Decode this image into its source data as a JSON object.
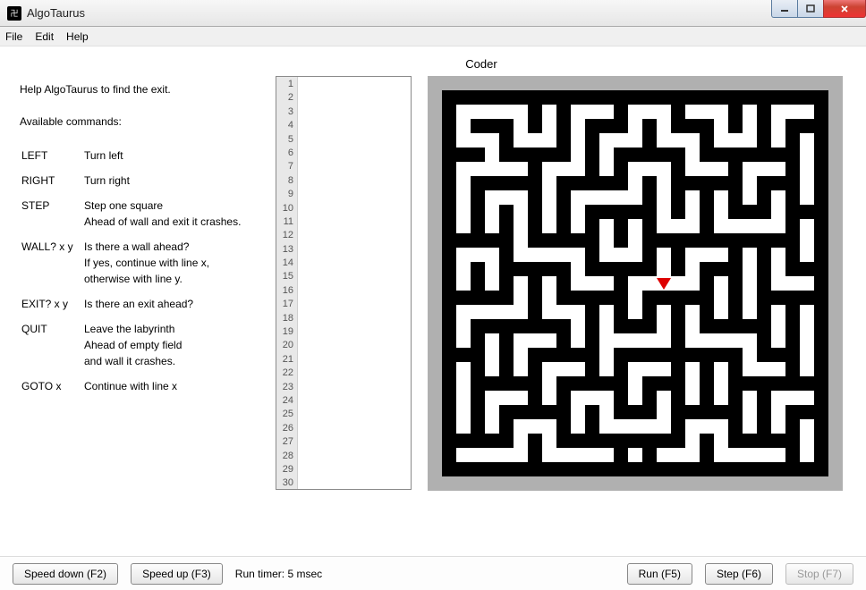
{
  "window": {
    "title": "AlgoTaurus",
    "icon_glyph": "卍"
  },
  "menu": [
    "File",
    "Edit",
    "Help"
  ],
  "labels": {
    "coder_header": "Coder"
  },
  "help": {
    "intro": "Help AlgoTaurus to find the exit.",
    "avail": "Available commands:",
    "cmds": [
      {
        "cmd": "LEFT",
        "desc": "Turn left"
      },
      {
        "cmd": "RIGHT",
        "desc": "Turn right"
      },
      {
        "cmd": "STEP",
        "desc": "Step one square\nAhead of wall and exit it crashes."
      },
      {
        "cmd": "WALL? x y",
        "desc": "Is there a wall ahead?\nIf yes, continue with line x,\notherwise with line y."
      },
      {
        "cmd": "EXIT? x y",
        "desc": "Is there an exit ahead?"
      },
      {
        "cmd": "QUIT",
        "desc": "Leave the labyrinth\nAhead of empty field\nand wall it crashes."
      },
      {
        "cmd": "GOTO x",
        "desc": "Continue with line x"
      }
    ]
  },
  "editor": {
    "line_count": 30
  },
  "maze": {
    "grid_size": 27,
    "player": {
      "col": 15,
      "row": 13
    },
    "open_cells": [
      [
        1,
        1
      ],
      [
        2,
        1
      ],
      [
        3,
        1
      ],
      [
        4,
        1
      ],
      [
        5,
        1
      ],
      [
        7,
        1
      ],
      [
        9,
        1
      ],
      [
        10,
        1
      ],
      [
        11,
        1
      ],
      [
        13,
        1
      ],
      [
        14,
        1
      ],
      [
        15,
        1
      ],
      [
        17,
        1
      ],
      [
        18,
        1
      ],
      [
        19,
        1
      ],
      [
        21,
        1
      ],
      [
        23,
        1
      ],
      [
        24,
        1
      ],
      [
        25,
        1
      ],
      [
        1,
        2
      ],
      [
        5,
        2
      ],
      [
        7,
        2
      ],
      [
        9,
        2
      ],
      [
        13,
        2
      ],
      [
        15,
        2
      ],
      [
        19,
        2
      ],
      [
        21,
        2
      ],
      [
        23,
        2
      ],
      [
        1,
        3
      ],
      [
        2,
        3
      ],
      [
        3,
        3
      ],
      [
        5,
        3
      ],
      [
        6,
        3
      ],
      [
        7,
        3
      ],
      [
        9,
        3
      ],
      [
        11,
        3
      ],
      [
        12,
        3
      ],
      [
        13,
        3
      ],
      [
        15,
        3
      ],
      [
        16,
        3
      ],
      [
        17,
        3
      ],
      [
        19,
        3
      ],
      [
        20,
        3
      ],
      [
        21,
        3
      ],
      [
        23,
        3
      ],
      [
        25,
        3
      ],
      [
        3,
        4
      ],
      [
        9,
        4
      ],
      [
        11,
        4
      ],
      [
        17,
        4
      ],
      [
        25,
        4
      ],
      [
        1,
        5
      ],
      [
        2,
        5
      ],
      [
        3,
        5
      ],
      [
        4,
        5
      ],
      [
        5,
        5
      ],
      [
        7,
        5
      ],
      [
        8,
        5
      ],
      [
        9,
        5
      ],
      [
        11,
        5
      ],
      [
        13,
        5
      ],
      [
        14,
        5
      ],
      [
        15,
        5
      ],
      [
        17,
        5
      ],
      [
        18,
        5
      ],
      [
        19,
        5
      ],
      [
        21,
        5
      ],
      [
        22,
        5
      ],
      [
        23,
        5
      ],
      [
        25,
        5
      ],
      [
        1,
        6
      ],
      [
        7,
        6
      ],
      [
        13,
        6
      ],
      [
        15,
        6
      ],
      [
        21,
        6
      ],
      [
        25,
        6
      ],
      [
        1,
        7
      ],
      [
        3,
        7
      ],
      [
        4,
        7
      ],
      [
        5,
        7
      ],
      [
        7,
        7
      ],
      [
        9,
        7
      ],
      [
        10,
        7
      ],
      [
        11,
        7
      ],
      [
        12,
        7
      ],
      [
        13,
        7
      ],
      [
        15,
        7
      ],
      [
        17,
        7
      ],
      [
        19,
        7
      ],
      [
        21,
        7
      ],
      [
        23,
        7
      ],
      [
        25,
        7
      ],
      [
        1,
        8
      ],
      [
        3,
        8
      ],
      [
        5,
        8
      ],
      [
        7,
        8
      ],
      [
        9,
        8
      ],
      [
        15,
        8
      ],
      [
        17,
        8
      ],
      [
        19,
        8
      ],
      [
        23,
        8
      ],
      [
        1,
        9
      ],
      [
        3,
        9
      ],
      [
        5,
        9
      ],
      [
        7,
        9
      ],
      [
        9,
        9
      ],
      [
        11,
        9
      ],
      [
        13,
        9
      ],
      [
        15,
        9
      ],
      [
        16,
        9
      ],
      [
        17,
        9
      ],
      [
        19,
        9
      ],
      [
        20,
        9
      ],
      [
        21,
        9
      ],
      [
        22,
        9
      ],
      [
        23,
        9
      ],
      [
        25,
        9
      ],
      [
        5,
        10
      ],
      [
        11,
        10
      ],
      [
        13,
        10
      ],
      [
        25,
        10
      ],
      [
        1,
        11
      ],
      [
        2,
        11
      ],
      [
        3,
        11
      ],
      [
        5,
        11
      ],
      [
        6,
        11
      ],
      [
        7,
        11
      ],
      [
        8,
        11
      ],
      [
        9,
        11
      ],
      [
        11,
        11
      ],
      [
        12,
        11
      ],
      [
        13,
        11
      ],
      [
        15,
        11
      ],
      [
        17,
        11
      ],
      [
        18,
        11
      ],
      [
        19,
        11
      ],
      [
        21,
        11
      ],
      [
        23,
        11
      ],
      [
        25,
        11
      ],
      [
        1,
        12
      ],
      [
        3,
        12
      ],
      [
        9,
        12
      ],
      [
        15,
        12
      ],
      [
        17,
        12
      ],
      [
        21,
        12
      ],
      [
        23,
        12
      ],
      [
        1,
        13
      ],
      [
        3,
        13
      ],
      [
        5,
        13
      ],
      [
        7,
        13
      ],
      [
        9,
        13
      ],
      [
        10,
        13
      ],
      [
        11,
        13
      ],
      [
        13,
        13
      ],
      [
        14,
        13
      ],
      [
        15,
        13
      ],
      [
        16,
        13
      ],
      [
        17,
        13
      ],
      [
        19,
        13
      ],
      [
        21,
        13
      ],
      [
        23,
        13
      ],
      [
        24,
        13
      ],
      [
        25,
        13
      ],
      [
        5,
        14
      ],
      [
        7,
        14
      ],
      [
        13,
        14
      ],
      [
        19,
        14
      ],
      [
        21,
        14
      ],
      [
        1,
        15
      ],
      [
        2,
        15
      ],
      [
        3,
        15
      ],
      [
        4,
        15
      ],
      [
        5,
        15
      ],
      [
        7,
        15
      ],
      [
        8,
        15
      ],
      [
        9,
        15
      ],
      [
        11,
        15
      ],
      [
        13,
        15
      ],
      [
        15,
        15
      ],
      [
        17,
        15
      ],
      [
        19,
        15
      ],
      [
        21,
        15
      ],
      [
        23,
        15
      ],
      [
        25,
        15
      ],
      [
        1,
        16
      ],
      [
        9,
        16
      ],
      [
        11,
        16
      ],
      [
        15,
        16
      ],
      [
        17,
        16
      ],
      [
        23,
        16
      ],
      [
        25,
        16
      ],
      [
        1,
        17
      ],
      [
        3,
        17
      ],
      [
        5,
        17
      ],
      [
        6,
        17
      ],
      [
        7,
        17
      ],
      [
        9,
        17
      ],
      [
        11,
        17
      ],
      [
        12,
        17
      ],
      [
        13,
        17
      ],
      [
        14,
        17
      ],
      [
        15,
        17
      ],
      [
        17,
        17
      ],
      [
        18,
        17
      ],
      [
        19,
        17
      ],
      [
        20,
        17
      ],
      [
        21,
        17
      ],
      [
        23,
        17
      ],
      [
        25,
        17
      ],
      [
        3,
        18
      ],
      [
        5,
        18
      ],
      [
        11,
        18
      ],
      [
        21,
        18
      ],
      [
        25,
        18
      ],
      [
        1,
        19
      ],
      [
        3,
        19
      ],
      [
        5,
        19
      ],
      [
        7,
        19
      ],
      [
        8,
        19
      ],
      [
        9,
        19
      ],
      [
        11,
        19
      ],
      [
        13,
        19
      ],
      [
        14,
        19
      ],
      [
        15,
        19
      ],
      [
        17,
        19
      ],
      [
        19,
        19
      ],
      [
        21,
        19
      ],
      [
        22,
        19
      ],
      [
        23,
        19
      ],
      [
        25,
        19
      ],
      [
        1,
        20
      ],
      [
        7,
        20
      ],
      [
        13,
        20
      ],
      [
        17,
        20
      ],
      [
        19,
        20
      ],
      [
        1,
        21
      ],
      [
        3,
        21
      ],
      [
        4,
        21
      ],
      [
        5,
        21
      ],
      [
        7,
        21
      ],
      [
        9,
        21
      ],
      [
        10,
        21
      ],
      [
        11,
        21
      ],
      [
        13,
        21
      ],
      [
        15,
        21
      ],
      [
        17,
        21
      ],
      [
        19,
        21
      ],
      [
        21,
        21
      ],
      [
        23,
        21
      ],
      [
        24,
        21
      ],
      [
        25,
        21
      ],
      [
        1,
        22
      ],
      [
        3,
        22
      ],
      [
        9,
        22
      ],
      [
        11,
        22
      ],
      [
        15,
        22
      ],
      [
        21,
        22
      ],
      [
        23,
        22
      ],
      [
        1,
        23
      ],
      [
        3,
        23
      ],
      [
        5,
        23
      ],
      [
        6,
        23
      ],
      [
        7,
        23
      ],
      [
        9,
        23
      ],
      [
        11,
        23
      ],
      [
        12,
        23
      ],
      [
        13,
        23
      ],
      [
        14,
        23
      ],
      [
        15,
        23
      ],
      [
        17,
        23
      ],
      [
        18,
        23
      ],
      [
        19,
        23
      ],
      [
        21,
        23
      ],
      [
        23,
        23
      ],
      [
        25,
        23
      ],
      [
        5,
        24
      ],
      [
        7,
        24
      ],
      [
        17,
        24
      ],
      [
        19,
        24
      ],
      [
        25,
        24
      ],
      [
        1,
        25
      ],
      [
        2,
        25
      ],
      [
        3,
        25
      ],
      [
        4,
        25
      ],
      [
        5,
        25
      ],
      [
        7,
        25
      ],
      [
        8,
        25
      ],
      [
        9,
        25
      ],
      [
        10,
        25
      ],
      [
        11,
        25
      ],
      [
        13,
        25
      ],
      [
        15,
        25
      ],
      [
        16,
        25
      ],
      [
        17,
        25
      ],
      [
        19,
        25
      ],
      [
        20,
        25
      ],
      [
        21,
        25
      ],
      [
        22,
        25
      ],
      [
        23,
        25
      ],
      [
        25,
        25
      ]
    ]
  },
  "bottom": {
    "speed_down": "Speed down (F2)",
    "speed_up": "Speed up (F3)",
    "run_timer": "Run timer: 5 msec",
    "run": "Run (F5)",
    "step": "Step (F6)",
    "stop": "Stop (F7)"
  }
}
